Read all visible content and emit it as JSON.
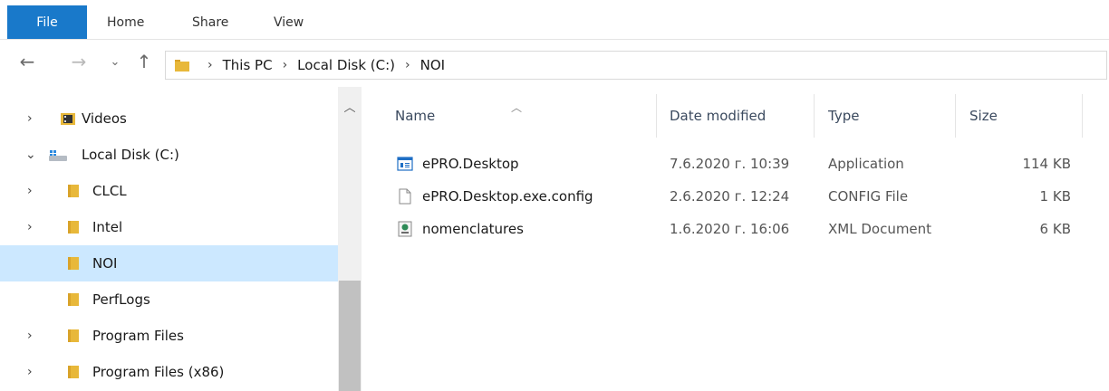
{
  "ribbon": {
    "tabs": [
      "File",
      "Home",
      "Share",
      "View"
    ]
  },
  "address": {
    "segments": [
      "This PC",
      "Local Disk (C:)",
      "NOI"
    ]
  },
  "tree": [
    {
      "label": "Videos",
      "icon": "videos-folder-icon"
    },
    {
      "label": "Local Disk (C:)",
      "icon": "drive-icon"
    },
    {
      "label": "CLCL",
      "icon": "folder-icon"
    },
    {
      "label": "Intel",
      "icon": "folder-icon"
    },
    {
      "label": "NOI",
      "icon": "folder-icon",
      "selected": true
    },
    {
      "label": "PerfLogs",
      "icon": "folder-icon"
    },
    {
      "label": "Program Files",
      "icon": "folder-icon"
    },
    {
      "label": "Program Files (x86)",
      "icon": "folder-icon"
    }
  ],
  "columns": {
    "name": "Name",
    "date": "Date modified",
    "type": "Type",
    "size": "Size"
  },
  "files": [
    {
      "name": "ePRO.Desktop",
      "date": "7.6.2020 г. 10:39",
      "type": "Application",
      "size": "114 KB",
      "icon": "application-icon"
    },
    {
      "name": "ePRO.Desktop.exe.config",
      "date": "2.6.2020 г. 12:24",
      "type": "CONFIG File",
      "size": "1 KB",
      "icon": "config-file-icon"
    },
    {
      "name": "nomenclatures",
      "date": "1.6.2020 г. 16:06",
      "type": "XML Document",
      "size": "6 KB",
      "icon": "xml-document-icon"
    }
  ],
  "colors": {
    "accent": "#1979ca",
    "selection": "#cce8ff",
    "folder": "#e8b83a"
  }
}
